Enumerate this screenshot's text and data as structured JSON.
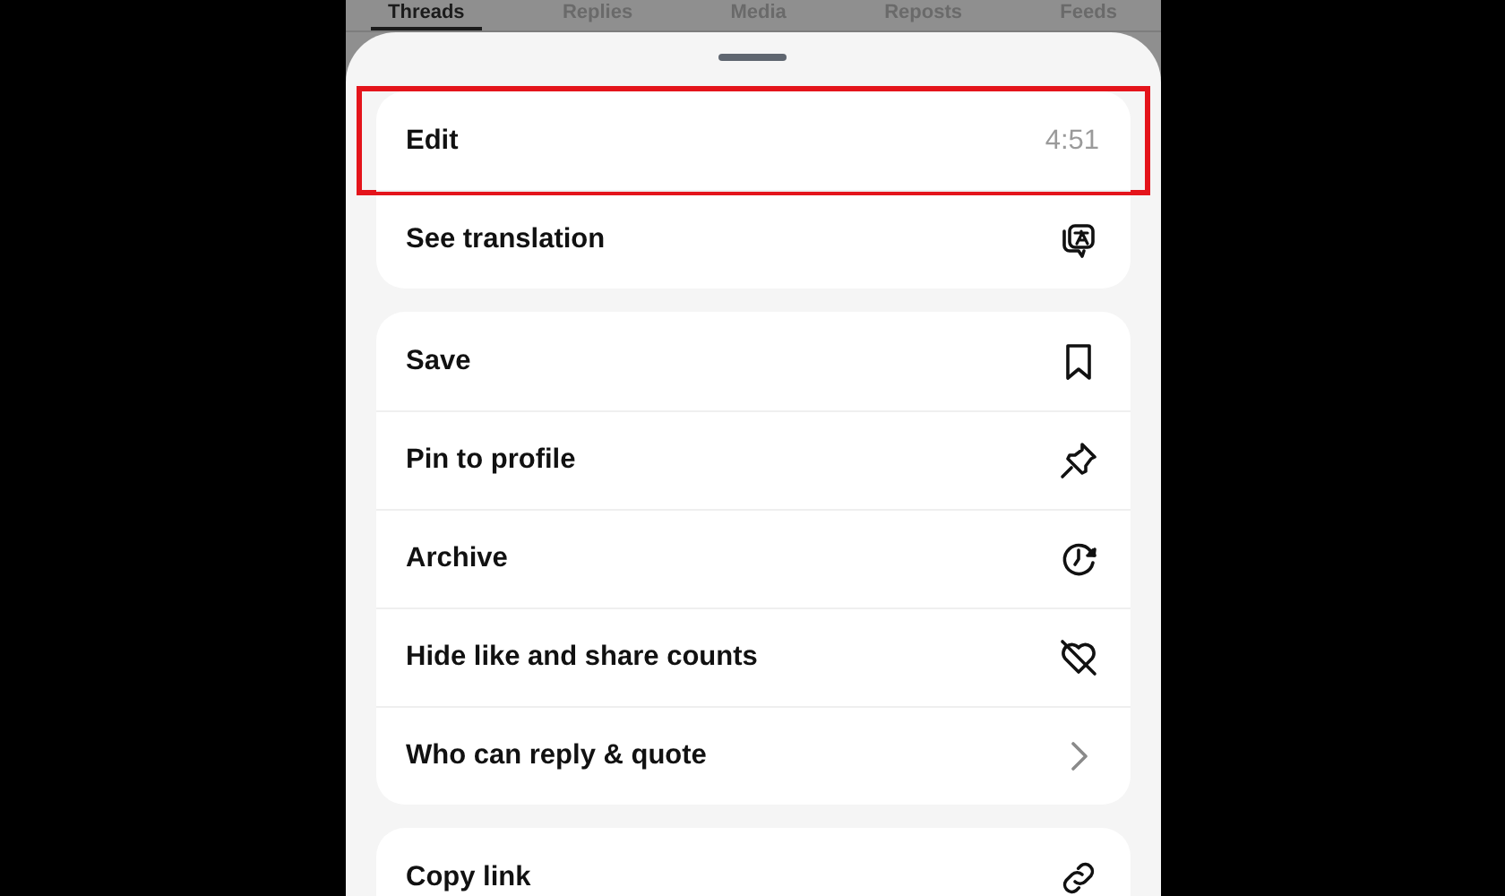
{
  "tabs": [
    {
      "label": "Threads",
      "selected": true
    },
    {
      "label": "Replies",
      "selected": false
    },
    {
      "label": "Media",
      "selected": false
    },
    {
      "label": "Reposts",
      "selected": false
    },
    {
      "label": "Feeds",
      "selected": false
    }
  ],
  "menu_groups": [
    {
      "items": [
        {
          "label": "Edit",
          "kind": "detail",
          "detail": "4:51",
          "highlighted": true
        },
        {
          "label": "See translation",
          "kind": "icon",
          "highlighted": false
        }
      ]
    },
    {
      "items": [
        {
          "label": "Save",
          "kind": "icon",
          "highlighted": false
        },
        {
          "label": "Pin to profile",
          "kind": "icon",
          "highlighted": false
        },
        {
          "label": "Archive",
          "kind": "icon",
          "highlighted": false
        },
        {
          "label": "Hide like and share counts",
          "kind": "icon",
          "highlighted": false
        },
        {
          "label": "Who can reply & quote",
          "kind": "chevron",
          "highlighted": false
        }
      ]
    },
    {
      "items": [
        {
          "label": "Copy link",
          "kind": "icon",
          "highlighted": false
        }
      ]
    }
  ]
}
